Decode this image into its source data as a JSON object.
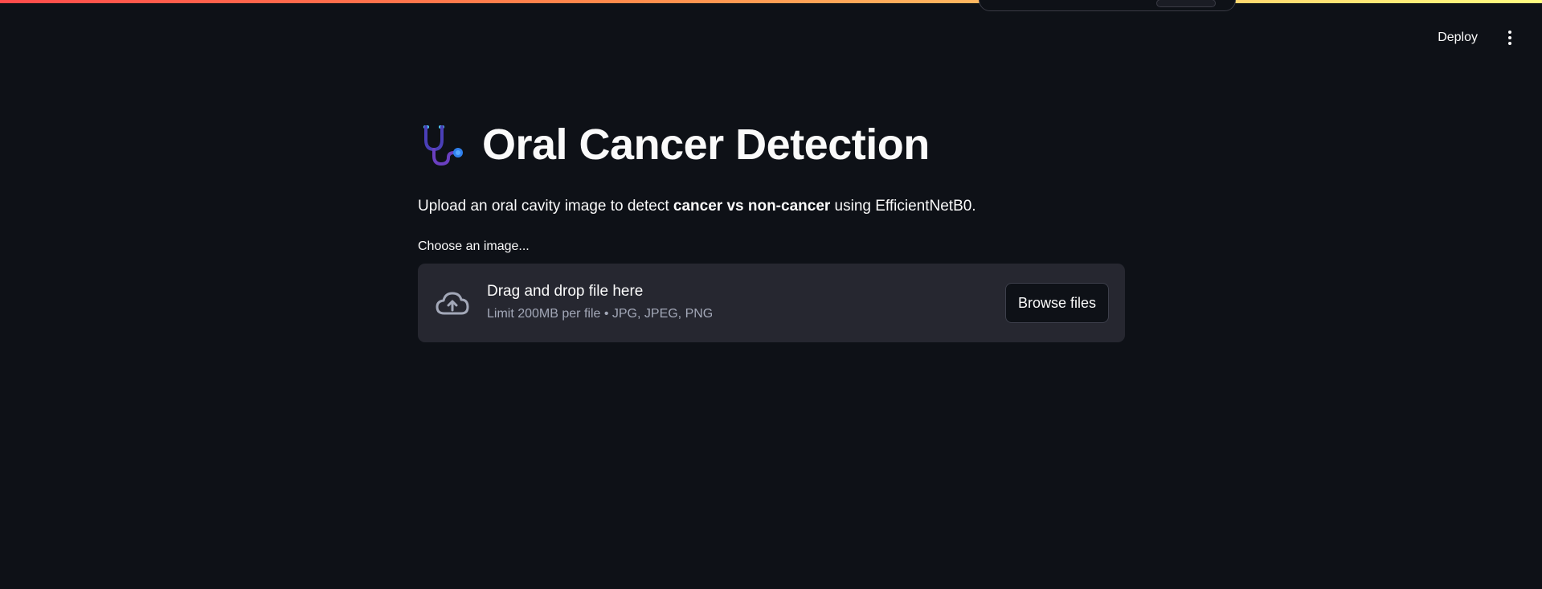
{
  "header": {
    "deploy_label": "Deploy",
    "menu_icon": "kebab-menu-icon"
  },
  "main": {
    "title_icon": "stethoscope-icon",
    "title": "Oral Cancer Detection",
    "subtitle": {
      "prefix": "Upload an oral cavity image to detect ",
      "bold": "cancer vs non-cancer",
      "suffix": " using EfficientNetB0."
    },
    "uploader": {
      "label": "Choose an image...",
      "icon": "cloud-upload-icon",
      "drop_text": "Drag and drop file here",
      "limit_text": "Limit 200MB per file • JPG, JPEG, PNG",
      "browse_label": "Browse files"
    }
  },
  "colors": {
    "background": "#0e1117",
    "dropzone": "#262730",
    "text": "#fafafa",
    "muted": "#a3a8b8",
    "top_bar_start": "#ff4b4b",
    "top_bar_end": "#fffd80"
  }
}
